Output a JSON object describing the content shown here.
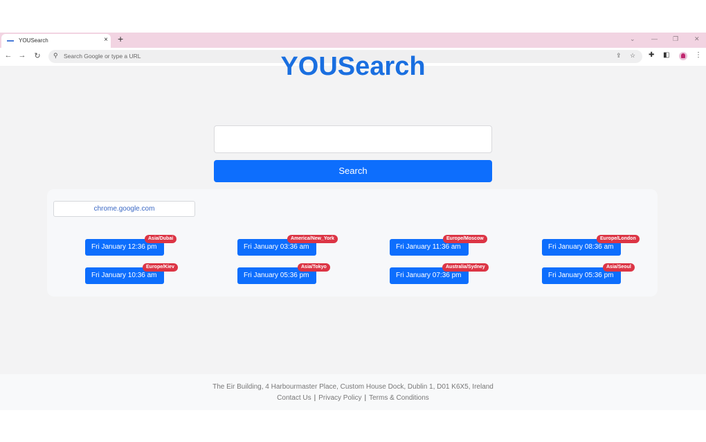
{
  "browser": {
    "tab_title": "YOUSearch",
    "tab_close": "×",
    "new_tab": "+",
    "omnibox_placeholder": "Search Google or type a URL",
    "win_min": "—",
    "win_max": "❐",
    "win_close": "✕",
    "dropdown": "⌄"
  },
  "page": {
    "logo": "YOUSearch",
    "search_button": "Search",
    "site_chip": "chrome.google.com",
    "clocks": [
      {
        "time": "Fri January 12:36 pm",
        "zone": "Asia/Dubai"
      },
      {
        "time": "Fri January 03:36 am",
        "zone": "America/New_York"
      },
      {
        "time": "Fri January 11:36 am",
        "zone": "Europe/Moscow"
      },
      {
        "time": "Fri January 08:36 am",
        "zone": "Europe/London"
      },
      {
        "time": "Fri January 10:36 am",
        "zone": "Europe/Kiev"
      },
      {
        "time": "Fri January 05:36 pm",
        "zone": "Asia/Tokyo"
      },
      {
        "time": "Fri January 07:36 pm",
        "zone": "Australia/Sydney"
      },
      {
        "time": "Fri January 05:36 pm",
        "zone": "Asia/Seoul"
      }
    ]
  },
  "footer": {
    "address": "The Eir Building, 4 Harbourmaster Place, Custom House Dock, Dublin 1, D01 K6X5, Ireland",
    "contact": "Contact Us",
    "privacy": "Privacy Policy",
    "terms": "Terms & Conditions",
    "sep": "|"
  },
  "colors": {
    "accent": "#0d6efd",
    "badge": "#dc3545",
    "tabstrip": "#f2d4e2"
  }
}
